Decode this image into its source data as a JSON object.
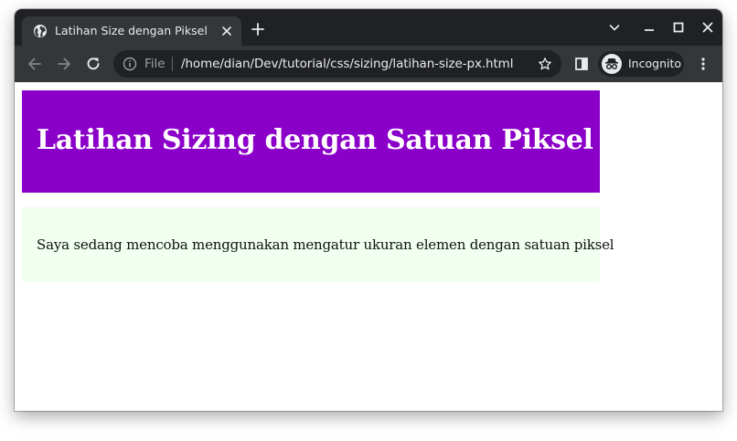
{
  "browser": {
    "tab": {
      "title": "Latihan Size dengan Piksel",
      "favicon": "globe-icon",
      "close_icon": "close-icon"
    },
    "new_tab_icon": "plus-icon",
    "window_controls": [
      "chevron-down-icon",
      "minimize-icon",
      "maximize-icon",
      "close-icon"
    ],
    "toolbar": {
      "back_icon": "arrow-left-icon",
      "forward_icon": "arrow-right-icon",
      "reload_icon": "reload-icon",
      "address_bar": {
        "info_icon": "info-icon",
        "scheme": "File",
        "url": "/home/dian/Dev/tutorial/css/sizing/latihan-size-px.html",
        "bookmark_icon": "star-icon"
      },
      "side_panel_icon": "side-panel-icon",
      "profile": {
        "icon": "incognito-icon",
        "label": "Incognito"
      },
      "menu_icon": "kebab-menu-icon"
    },
    "colors": {
      "tabstrip": "#202124",
      "toolbar": "#35363a",
      "text": "#e8eaed"
    }
  },
  "page": {
    "header": {
      "heading": "Latihan Sizing dengan Satuan Piksel",
      "background": "#8b00c9"
    },
    "content": {
      "paragraph": "Saya sedang mencoba menggunakan mengatur ukuran elemen dengan satuan piksel",
      "background": "#f0fff0"
    }
  }
}
